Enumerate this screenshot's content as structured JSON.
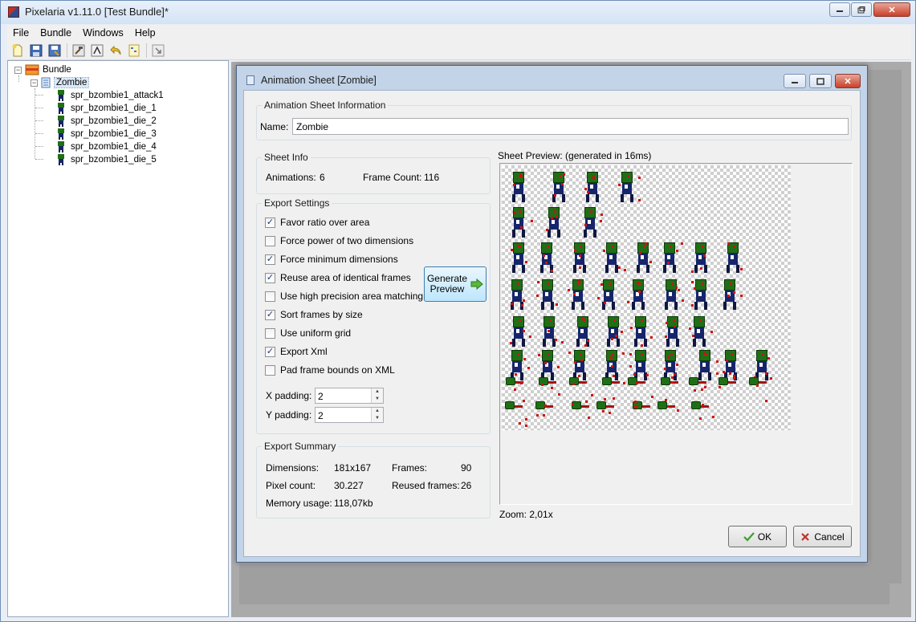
{
  "app": {
    "title": "Pixelaria v1.11.0 [Test Bundle]*",
    "window_buttons": [
      "minimize",
      "maximize",
      "close"
    ]
  },
  "menu": [
    "File",
    "Bundle",
    "Windows",
    "Help"
  ],
  "toolbar": {
    "icons": [
      "new-file-icon",
      "save-icon",
      "save-as-icon",
      "hammer-icon",
      "export-icon",
      "undo-icon",
      "tree-icon",
      "arrow-icon"
    ]
  },
  "tree": {
    "root": "Bundle",
    "sheet": "Zombie",
    "animations": [
      "spr_bzombie1_attack1",
      "spr_bzombie1_die_1",
      "spr_bzombie1_die_2",
      "spr_bzombie1_die_3",
      "spr_bzombie1_die_4",
      "spr_bzombie1_die_5"
    ]
  },
  "dialog": {
    "title": "Animation Sheet [Zombie]",
    "info_group": "Animation Sheet Information",
    "name_label": "Name:",
    "name_value": "Zombie",
    "sheet_info": {
      "title": "Sheet Info",
      "animations_label": "Animations:",
      "animations_value": "6",
      "frame_count_label": "Frame Count:",
      "frame_count_value": "116"
    },
    "export_settings": {
      "title": "Export Settings",
      "options": [
        {
          "label": "Favor ratio over area",
          "checked": true
        },
        {
          "label": "Force power of two dimensions",
          "checked": false
        },
        {
          "label": "Force minimum dimensions",
          "checked": true
        },
        {
          "label": "Reuse area of identical frames",
          "checked": true
        },
        {
          "label": "Use high precision area matching",
          "checked": false
        },
        {
          "label": "Sort frames by size",
          "checked": true
        },
        {
          "label": "Use uniform grid",
          "checked": false
        },
        {
          "label": "Export Xml",
          "checked": true
        },
        {
          "label": "Pad frame bounds on XML",
          "checked": false
        }
      ],
      "x_padding_label": "X padding:",
      "x_padding_value": "2",
      "y_padding_label": "Y padding:",
      "y_padding_value": "2",
      "generate_line1": "Generate",
      "generate_line2": "Preview"
    },
    "summary": {
      "title": "Export Summary",
      "dimensions_label": "Dimensions:",
      "dimensions_value": "181x167",
      "frames_label": "Frames:",
      "frames_value": "90",
      "pixel_count_label": "Pixel count:",
      "pixel_count_value": "30.227",
      "reused_label": "Reused frames:",
      "reused_value": "26",
      "memory_label": "Memory usage:",
      "memory_value": "118,07kb"
    },
    "preview_label": "Sheet Preview: (generated in 16ms)",
    "zoom_label": "Zoom: 2,01x",
    "ok_label": "OK",
    "cancel_label": "Cancel"
  },
  "colors": {
    "zombie_green": "#1f6f16",
    "zombie_blue": "#16256b",
    "blood_red": "#d01010",
    "ok_check": "#3aa02c",
    "cancel_x": "#c2302b"
  }
}
